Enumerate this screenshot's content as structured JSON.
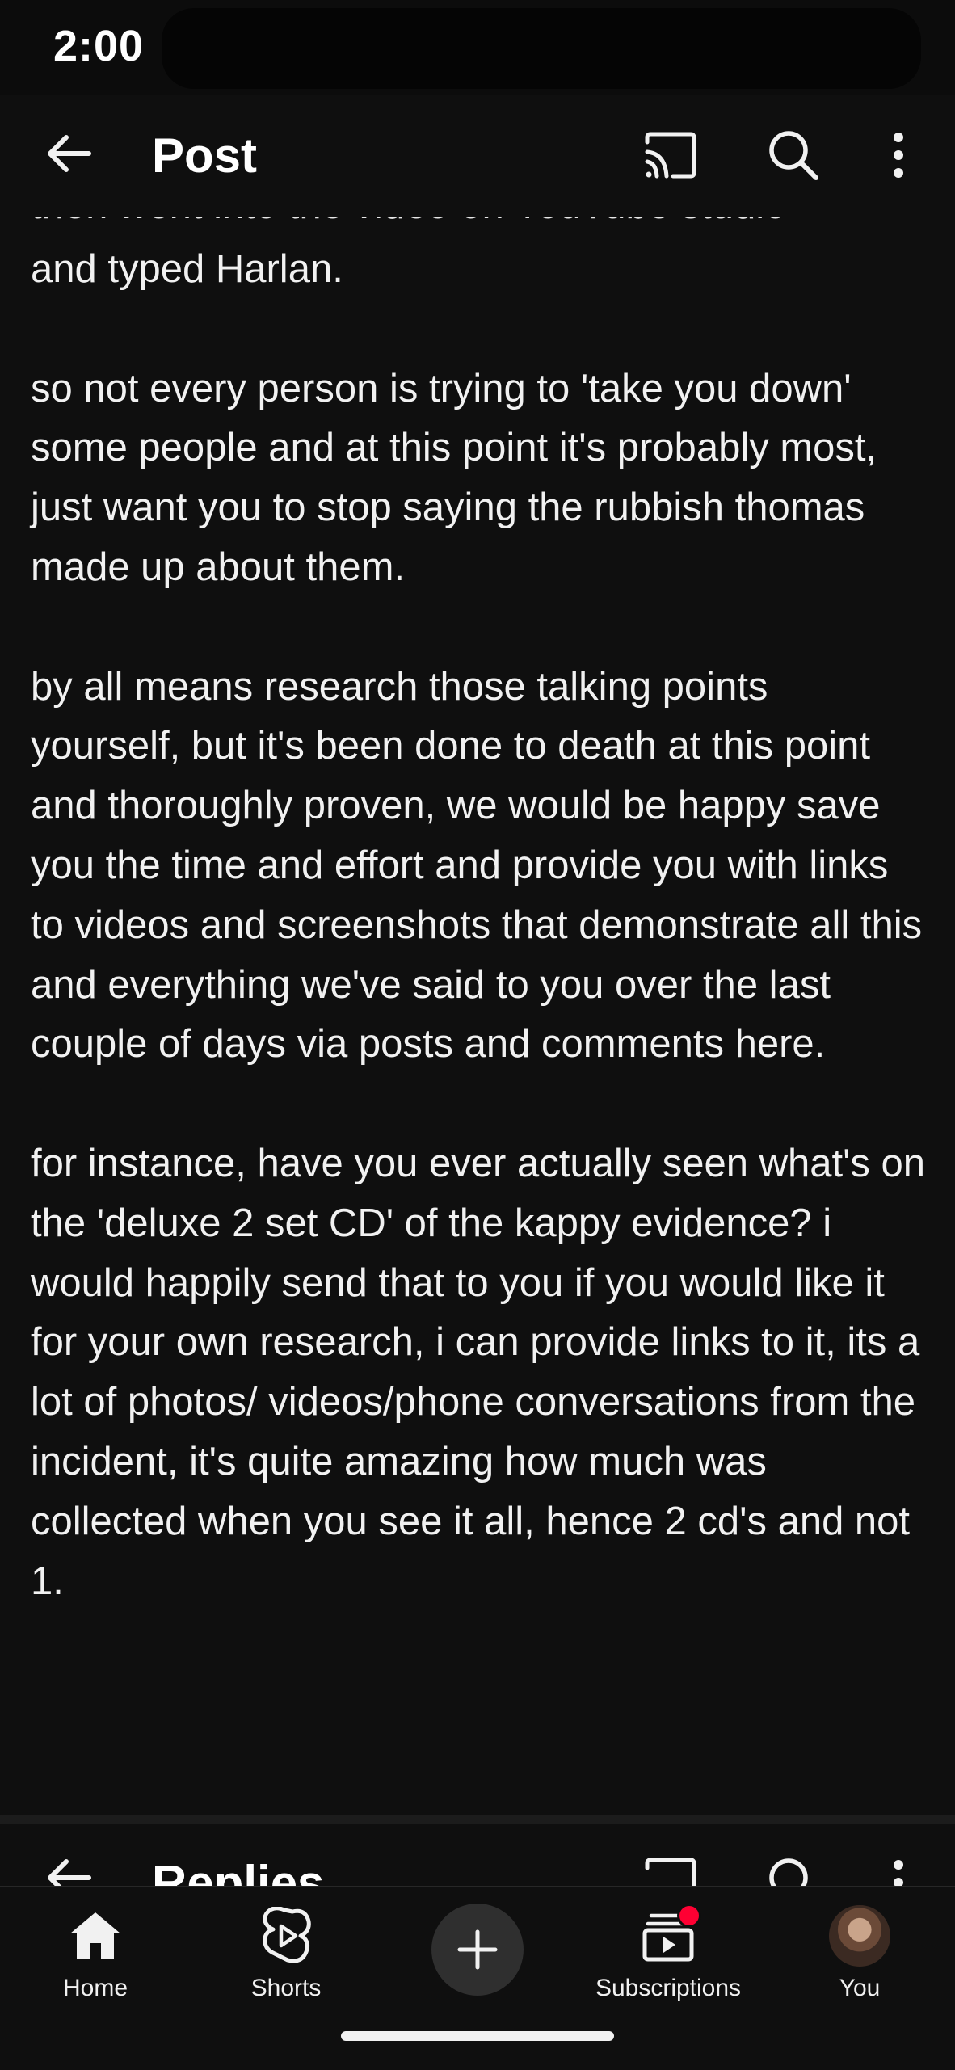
{
  "status_bar": {
    "time": "2:00"
  },
  "header": {
    "title": "Post",
    "icons": [
      "back-arrow-icon",
      "cast-icon",
      "search-icon",
      "more-vertical-icon"
    ]
  },
  "post": {
    "cutoff_line": "then went into the video on YouTube studio",
    "paragraphs": [
      "and typed Harlan.",
      "so not every person is trying to 'take you down' some people and at this point it's probably most, just want you to stop saying the rubbish thomas made up about them.",
      "by all means research those talking points yourself, but it's been done to death at this point and thoroughly proven, we would be happy save you the time and effort and provide you with links to videos and screenshots that demonstrate all this and everything we've said to you over the last couple of days via posts and comments here.",
      "for instance, have you ever actually seen what's on the 'deluxe 2 set CD' of the kappy evidence? i would happily send that to you if you would like it for your own research, i can provide links to it, its a lot of photos/ videos/phone conversations from the incident, it's quite amazing how much was collected when you see it all, hence 2 cd's and not 1."
    ]
  },
  "replies_panel": {
    "title": "Replies"
  },
  "bottom_nav": {
    "home": "Home",
    "shorts": "Shorts",
    "subscriptions": "Subscriptions",
    "you": "You"
  },
  "colors": {
    "background": "#0f0f0f",
    "text": "#f1f1f1",
    "notification": "#ff0033"
  }
}
